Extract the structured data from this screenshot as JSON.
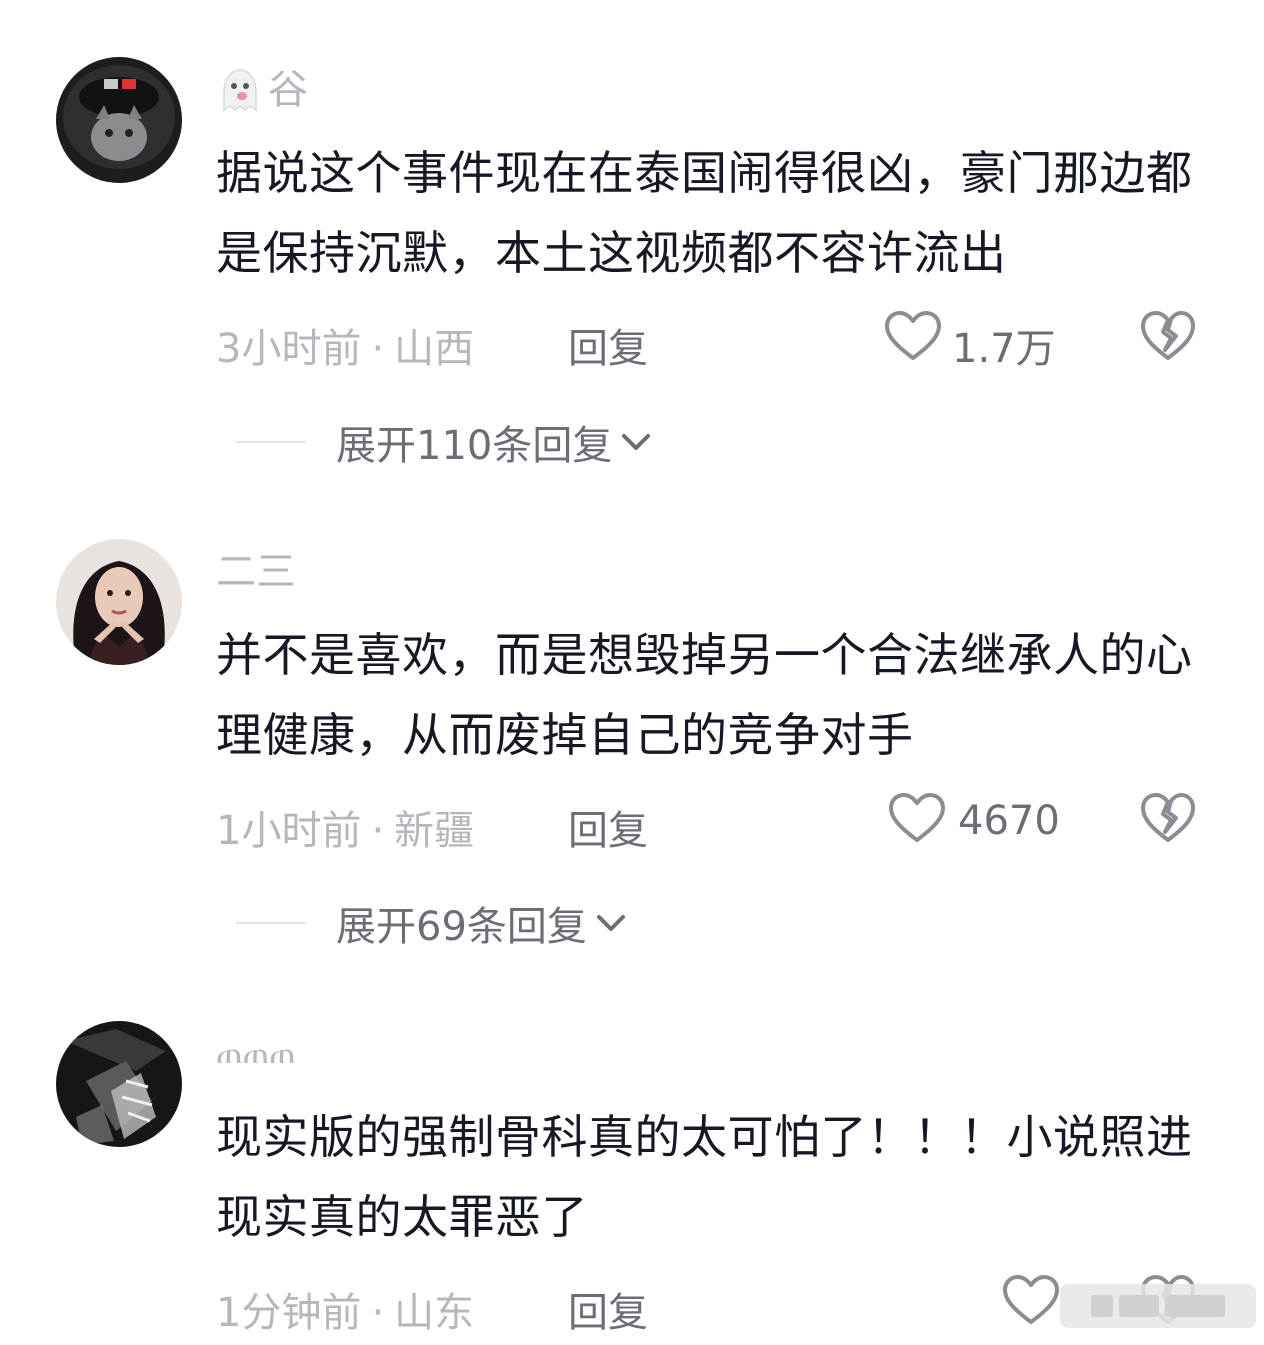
{
  "comments": [
    {
      "username": "谷",
      "text": "据说这个事件现在在泰国闹得很凶，豪门那边都是保持沉默，本土这视频都不容许流出",
      "time": "3小时前",
      "location": "山西",
      "reply_label": "回复",
      "likes": "1.7万",
      "expand_label": "展开110条回复"
    },
    {
      "username": "二三",
      "text": "并不是喜欢，而是想毁掉另一个合法继承人的心理健康，从而废掉自己的竞争对手",
      "time": "1小时前",
      "location": "新疆",
      "reply_label": "回复",
      "likes": "4670",
      "expand_label": "展开69条回复"
    },
    {
      "username": "ጠጠጠ",
      "text": "现实版的强制骨科真的太可怕了！！！小说照进现实真的太罪恶了",
      "time": "1分钟前",
      "location": "山东",
      "reply_label": "回复",
      "likes": ""
    }
  ],
  "meta_separator": "·",
  "colors": {
    "text": "#161823",
    "muted": "#b5b7bd",
    "secondary": "#6b6e77"
  }
}
